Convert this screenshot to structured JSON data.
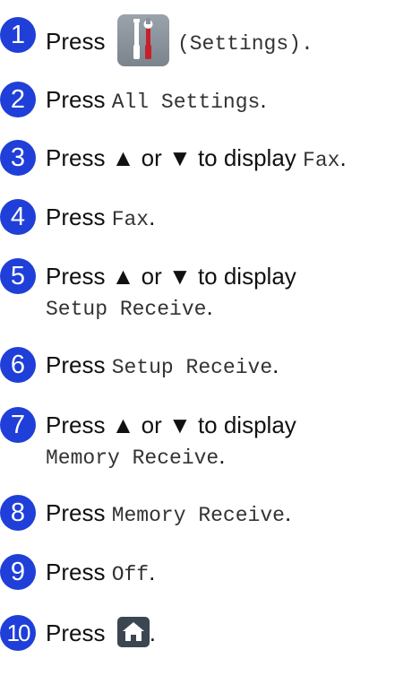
{
  "steps": [
    {
      "number": "1",
      "lines": [
        {
          "press": "Press",
          "after": " (Settings).",
          "icon": "settings-icon"
        }
      ]
    },
    {
      "number": "2",
      "lines": [
        {
          "press": "Press",
          "mono": "All Settings",
          "tail": "."
        }
      ]
    },
    {
      "number": "3",
      "lines": [
        {
          "press": "Press ▲ or ▼ to display",
          "mono": "Fax",
          "tail": "."
        }
      ]
    },
    {
      "number": "4",
      "lines": [
        {
          "press": "Press",
          "mono": "Fax",
          "tail": "."
        }
      ]
    },
    {
      "number": "5",
      "lines": [
        {
          "press": "Press ▲ or ▼ to display"
        },
        {
          "mono": "Setup Receive",
          "tail": "."
        }
      ]
    },
    {
      "number": "6",
      "lines": [
        {
          "press": "Press",
          "mono": "Setup Receive",
          "tail": "."
        }
      ]
    },
    {
      "number": "7",
      "lines": [
        {
          "press": "Press ▲ or ▼ to display"
        },
        {
          "mono": "Memory Receive",
          "tail": "."
        }
      ]
    },
    {
      "number": "8",
      "lines": [
        {
          "press": "Press",
          "mono": "Memory Receive",
          "tail": "."
        }
      ]
    },
    {
      "number": "9",
      "lines": [
        {
          "press": "Press",
          "mono": "Off",
          "tail": "."
        }
      ]
    },
    {
      "number": "10",
      "lines": [
        {
          "press": "Press",
          "tail": ".",
          "icon": "home-icon"
        }
      ]
    }
  ],
  "colors": {
    "badge": "#1f3fd8",
    "settings_icon": "#8a939b",
    "home_icon": "#3b4652"
  }
}
